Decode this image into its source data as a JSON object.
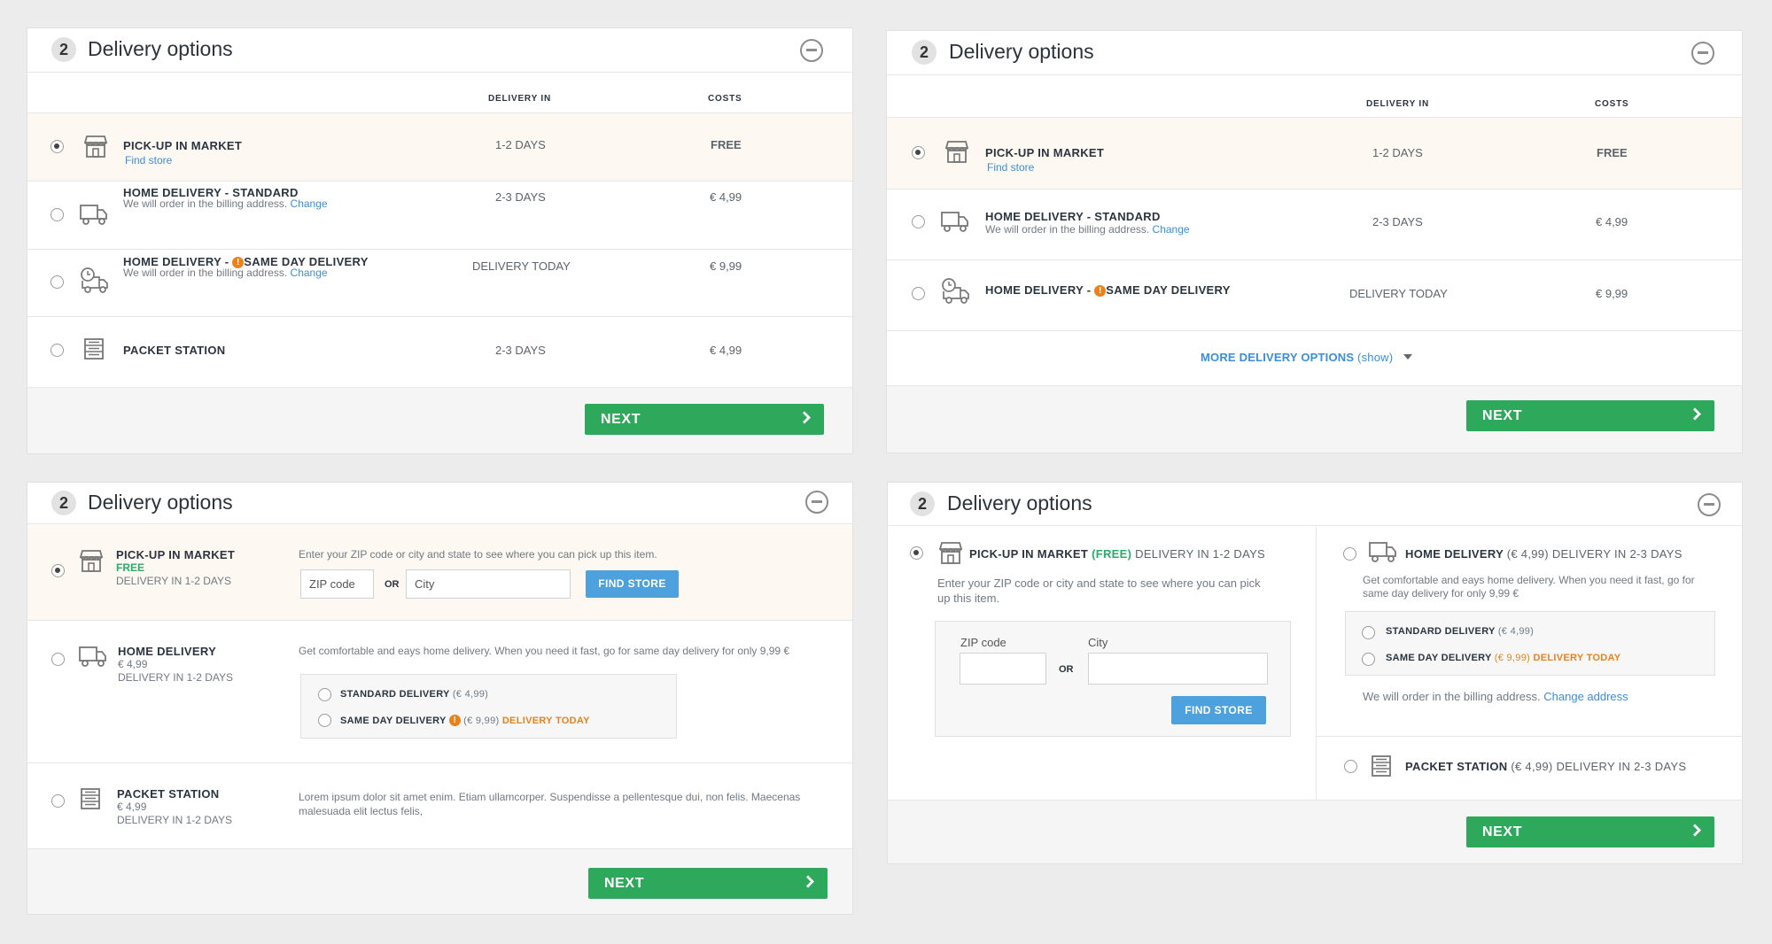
{
  "colors": {
    "accent_green": "#2ea95c",
    "link_blue": "#3a8fd8",
    "orange": "#e7821f",
    "selected_row": "#fdf8f2"
  },
  "icons": [
    "store-icon",
    "truck-icon",
    "clock-truck-icon",
    "packet-station-icon",
    "collapse-icon",
    "chevron-right-icon",
    "caret-down-icon",
    "warning-icon"
  ],
  "panel1": {
    "step": "2",
    "title": "Delivery options",
    "col_delivery": "DELIVERY IN",
    "col_costs": "COSTS",
    "rows": [
      {
        "name": "PICK-UP IN MARKET",
        "link": "Find store",
        "days": "1-2 DAYS",
        "cost": "FREE"
      },
      {
        "name": "HOME DELIVERY  - STANDARD",
        "sub": "We will order in the billing address.",
        "link": "Change",
        "days": "2-3 DAYS",
        "cost": "€ 4,99"
      },
      {
        "name_a": "HOME DELIVERY  - ",
        "name_b": "SAME DAY DELIVERY",
        "sub": "We will order in the billing address.",
        "link": "Change",
        "days": "DELIVERY TODAY",
        "cost": "€ 9,99"
      },
      {
        "name": "PACKET STATION",
        "days": "2-3 DAYS",
        "cost": "€ 4,99"
      }
    ],
    "next": "NEXT"
  },
  "panel2": {
    "step": "2",
    "title": "Delivery options",
    "col_delivery": "DELIVERY IN",
    "col_costs": "COSTS",
    "rows": [
      {
        "name": "PICK-UP IN MARKET",
        "link": "Find store",
        "days": "1-2 DAYS",
        "cost": "FREE"
      },
      {
        "name": "HOME DELIVERY  - STANDARD",
        "sub": "We will order in the billing address.",
        "link": "Change",
        "days": "2-3 DAYS",
        "cost": "€ 4,99"
      },
      {
        "name_a": "HOME DELIVERY  - ",
        "name_b": "SAME DAY DELIVERY",
        "days": "DELIVERY TODAY",
        "cost": "€ 9,99"
      }
    ],
    "more": "MORE DELIVERY OPTIONS",
    "more_show": "(show)",
    "next": "NEXT"
  },
  "panel3": {
    "step": "2",
    "title": "Delivery options",
    "pickup": {
      "name": "PICK-UP IN MARKET",
      "price": "FREE",
      "days": "DELIVERY IN 1-2 DAYS",
      "desc": "Enter your ZIP code or city and state to see where you can pick up this item.",
      "zip_placeholder": "ZIP code",
      "or": "OR",
      "city_placeholder": "City",
      "button": "FIND STORE"
    },
    "home": {
      "name": "HOME DELIVERY",
      "price": "€ 4,99",
      "days": "DELIVERY IN 1-2 DAYS",
      "desc": "Get comfortable and eays home delivery. When you need it fast, go for same day delivery for only 9,99 €",
      "opt1": "STANDARD DELIVERY",
      "opt1_price": "(€ 4,99)",
      "opt2": "SAME DAY DELIVERY",
      "opt2_price": "(€ 9,99)",
      "opt2_tag": "DELIVERY TODAY"
    },
    "packet": {
      "name": "PACKET STATION",
      "price": "€ 4,99",
      "days": "DELIVERY IN 1-2 DAYS",
      "desc1": "Lorem ipsum dolor sit amet enim. Etiam ullamcorper. Suspendisse a pellentesque dui, non felis. Maecenas",
      "desc2": "malesuada elit lectus felis,"
    },
    "next": "NEXT"
  },
  "panel4": {
    "step": "2",
    "title": "Delivery options",
    "pickup": {
      "name": "PICK-UP IN MARKET",
      "free": "(FREE)",
      "days": "DELIVERY IN 1-2 DAYS",
      "desc1": "Enter your ZIP code or city and state to see where you can pick",
      "desc2": "up this item.",
      "zip_label": "ZIP code",
      "city_label": "City",
      "or": "OR",
      "button": "FIND STORE"
    },
    "home": {
      "name": "HOME DELIVERY",
      "price": "(€ 4,99)",
      "days": "DELIVERY IN 2-3 DAYS",
      "desc1": "Get comfortable and eays home delivery. When you need it fast, go for",
      "desc2": "same day delivery for only 9,99 €",
      "opt1": "STANDARD DELIVERY",
      "opt1_price": "(€ 4,99)",
      "opt2": "SAME DAY DELIVERY",
      "opt2_price": "(€ 9,99)",
      "opt2_tag": "DELIVERY TODAY",
      "note": "We will order in the billing address.",
      "note_link": "Change address"
    },
    "packet": {
      "name": "PACKET STATION",
      "price": "(€ 4,99)",
      "days": "DELIVERY IN 2-3 DAYS"
    },
    "next": "NEXT"
  }
}
